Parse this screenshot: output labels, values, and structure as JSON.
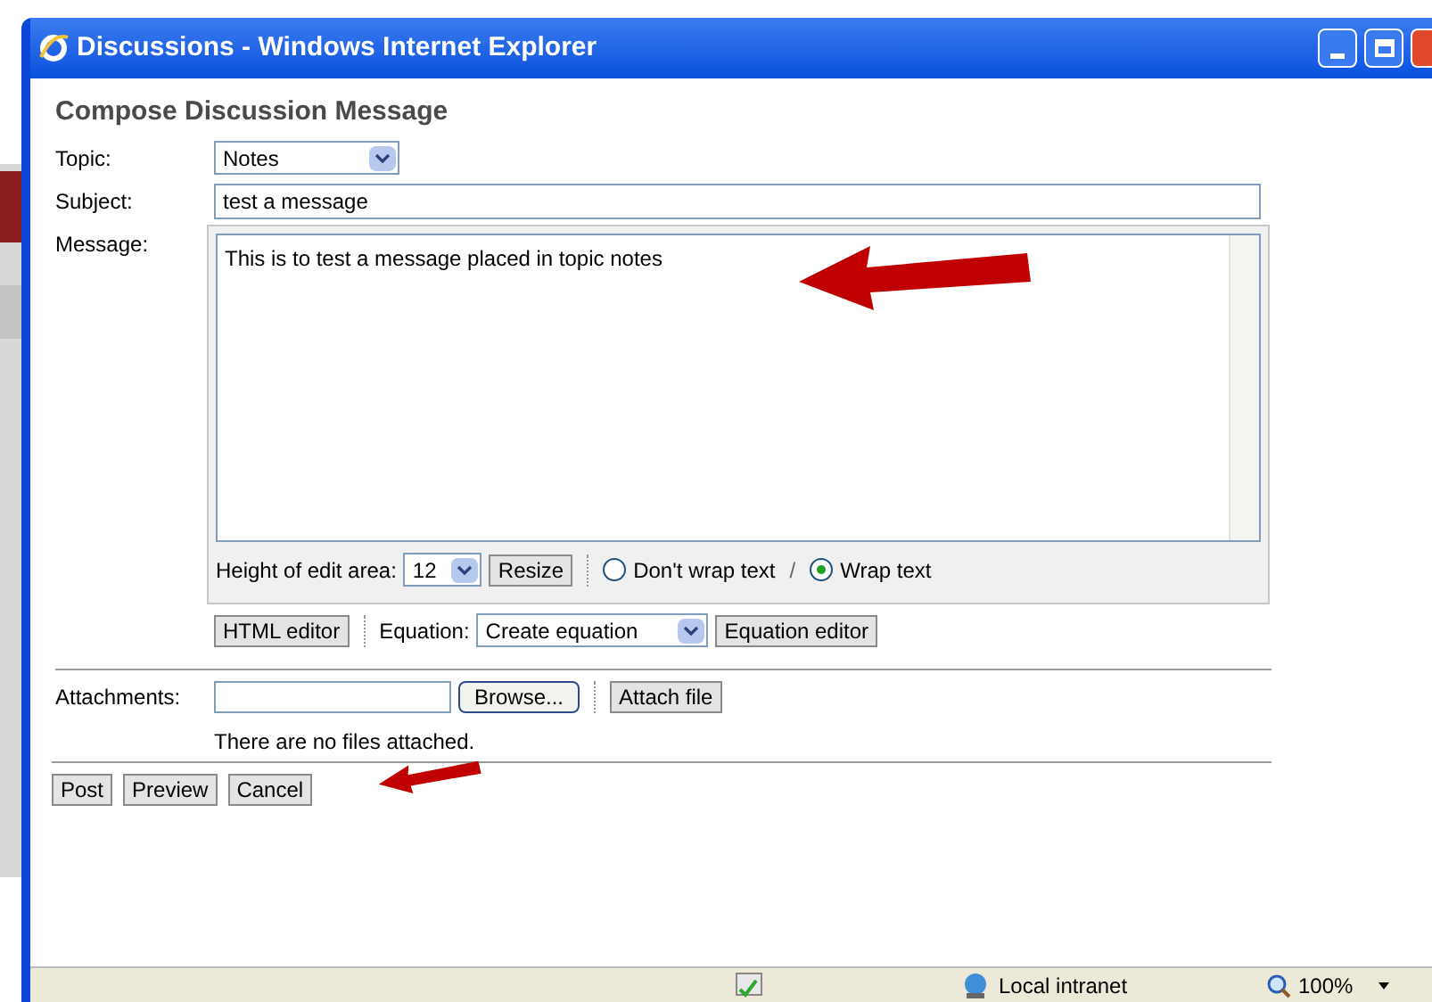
{
  "window": {
    "title": "Discussions - Windows Internet Explorer"
  },
  "heading": "Compose Discussion Message",
  "topic": {
    "label": "Topic:",
    "value": "Notes"
  },
  "subject": {
    "label": "Subject:",
    "value": "test a message"
  },
  "message": {
    "label": "Message:",
    "value": "This is to test a message placed in topic notes"
  },
  "edit_area": {
    "label": "Height of edit area:",
    "value": "12",
    "button": "Resize"
  },
  "wrap_options": [
    {
      "label": "Don't wrap text",
      "selected": false
    },
    {
      "label": "Wrap text",
      "selected": true
    }
  ],
  "wrap_separator": "/",
  "html_editor": "HTML editor",
  "equation": {
    "label": "Equation:",
    "value": "Create equation",
    "button": "Equation editor"
  },
  "attachments": {
    "label": "Attachments:",
    "browse": "Browse...",
    "attach": "Attach file",
    "note": "There are no files attached."
  },
  "buttons": [
    "Post",
    "Preview",
    "Cancel"
  ],
  "status_bar": {
    "zone": "Local intranet",
    "zoom": "100%"
  }
}
